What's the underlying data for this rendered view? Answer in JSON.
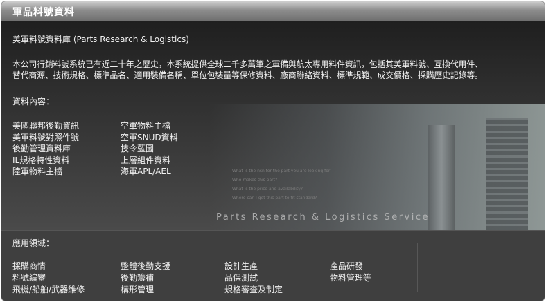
{
  "header": {
    "title": "軍品料號資料"
  },
  "intro": {
    "subtitle": "美軍料號資料庫 (Parts Research & Logistics)",
    "paragraph_line1": "本公司行銷料號系統已有近二十年之歷史，本系統提供全球二千多萬筆之軍備與航太專用料件資訊，包括其美軍料號、互換代用件、",
    "paragraph_line2": "替代商源、技術規格、標準品名、適用裝備名稱、單位包裝量等保修資料、廠商聯絡資料、標準規範、成交價格、採購歷史記錄等。"
  },
  "contents": {
    "heading": "資料內容：",
    "col1": [
      "美國聯邦後勤資訊",
      "美軍料號對照件號",
      "後勤管理資料庫",
      "IL規格特性資料",
      "陸軍物料主檔"
    ],
    "col2": [
      "空軍物料主檔",
      "空軍SNUD資料",
      "技令藍圖",
      "上層組件資料",
      "海軍APL/AEL"
    ]
  },
  "banner": {
    "watermark": "Parts Research & Logistics Service",
    "faint_lines": [
      "What is the nsn for the part you are looking for",
      "Who makes this part?",
      "What is the price and availability?",
      "Where can I get this part to fit standard?"
    ]
  },
  "applications": {
    "heading": "應用領域：",
    "col1": [
      "採購商情",
      "料號編審",
      "飛機/船舶/武器維修"
    ],
    "col2": [
      "整體後勤支援",
      "後勤籌補",
      "構形管理"
    ],
    "col3": [
      "設計生產",
      "品保測試",
      "規格審查及制定"
    ],
    "col4": [
      "產品研發",
      "物料管理等"
    ]
  }
}
